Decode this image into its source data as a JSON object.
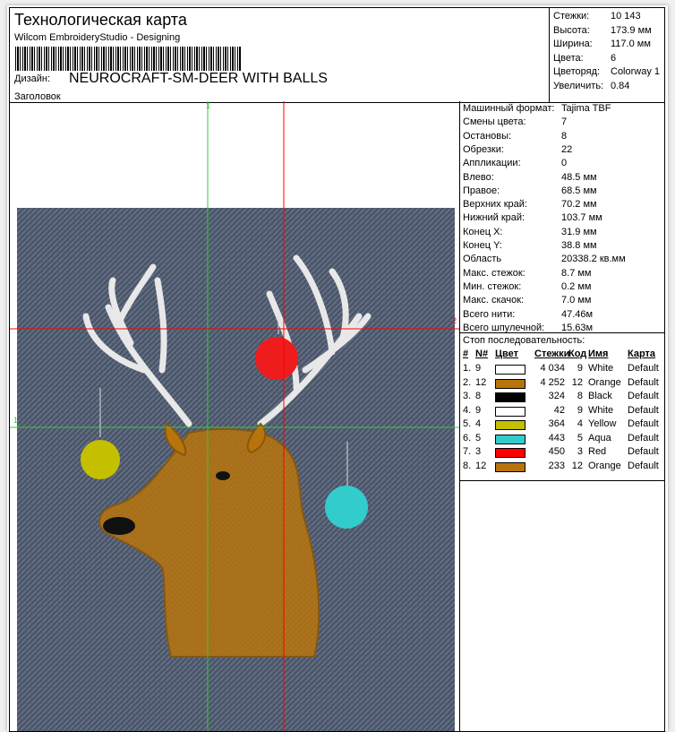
{
  "header": {
    "title": "Технологическая карта",
    "subtitle": "Wilcom EmbroideryStudio - Designing",
    "design_label": "Дизайн:",
    "design_name": "NEUROCRAFT-SM-DEER WITH BALLS",
    "heading_label": "Заголовок"
  },
  "summary": [
    [
      "Стежки:",
      "10 143"
    ],
    [
      "Высота:",
      "173.9 мм"
    ],
    [
      "Ширина:",
      "117.0 мм"
    ],
    [
      "Цвета:",
      "6"
    ],
    [
      "Цветоряд:",
      "Colorway 1"
    ],
    [
      "Увеличить:",
      "0.84"
    ]
  ],
  "details": [
    [
      "Машинный формат:",
      "Tajima TBF"
    ],
    [
      "Смены цвета:",
      "7"
    ],
    [
      "Остановы:",
      "8"
    ],
    [
      "Обрезки:",
      "22"
    ],
    [
      "Аппликации:",
      "0"
    ],
    [
      "Влево:",
      "48.5 мм"
    ],
    [
      "Правое:",
      "68.5 мм"
    ],
    [
      "Верхних край:",
      "70.2 мм"
    ],
    [
      "Нижний край:",
      "103.7 мм"
    ],
    [
      "Конец X:",
      "31.9 мм"
    ],
    [
      "Конец Y:",
      "38.8 мм"
    ],
    [
      "Область",
      "20338.2 кв.мм"
    ],
    [
      "Макс. стежок:",
      "8.7 мм"
    ],
    [
      "Мин. стежок:",
      "0.2 мм"
    ],
    [
      "Макс. скачок:",
      "7.0 мм"
    ],
    [
      "Всего нити:",
      "47.46м"
    ],
    [
      "Всего шпулечной:",
      "15.63м"
    ]
  ],
  "sequence": {
    "title": "Стоп последовательность:",
    "columns": [
      "#",
      "N#",
      "Цвет",
      "Стежки",
      "Код",
      "Имя",
      "Карта"
    ],
    "rows": [
      {
        "n": "1.",
        "nn": "9",
        "color": "#ffffff",
        "stitches": "4 034",
        "code": "9",
        "name": "White",
        "chart": "Default"
      },
      {
        "n": "2.",
        "nn": "12",
        "color": "#b8740c",
        "stitches": "4 252",
        "code": "12",
        "name": "Orange",
        "chart": "Default"
      },
      {
        "n": "3.",
        "nn": "8",
        "color": "#000000",
        "stitches": "324",
        "code": "8",
        "name": "Black",
        "chart": "Default"
      },
      {
        "n": "4.",
        "nn": "9",
        "color": "#ffffff",
        "stitches": "42",
        "code": "9",
        "name": "White",
        "chart": "Default"
      },
      {
        "n": "5.",
        "nn": "4",
        "color": "#c4c000",
        "stitches": "364",
        "code": "4",
        "name": "Yellow",
        "chart": "Default"
      },
      {
        "n": "6.",
        "nn": "5",
        "color": "#33cccc",
        "stitches": "443",
        "code": "5",
        "name": "Aqua",
        "chart": "Default"
      },
      {
        "n": "7.",
        "nn": "3",
        "color": "#ff0000",
        "stitches": "450",
        "code": "3",
        "name": "Red",
        "chart": "Default"
      },
      {
        "n": "8.",
        "nn": "12",
        "color": "#b8740c",
        "stitches": "233",
        "code": "12",
        "name": "Orange",
        "chart": "Default"
      }
    ]
  },
  "guides": {
    "v1": "1",
    "h1": "1",
    "v2": "2"
  }
}
